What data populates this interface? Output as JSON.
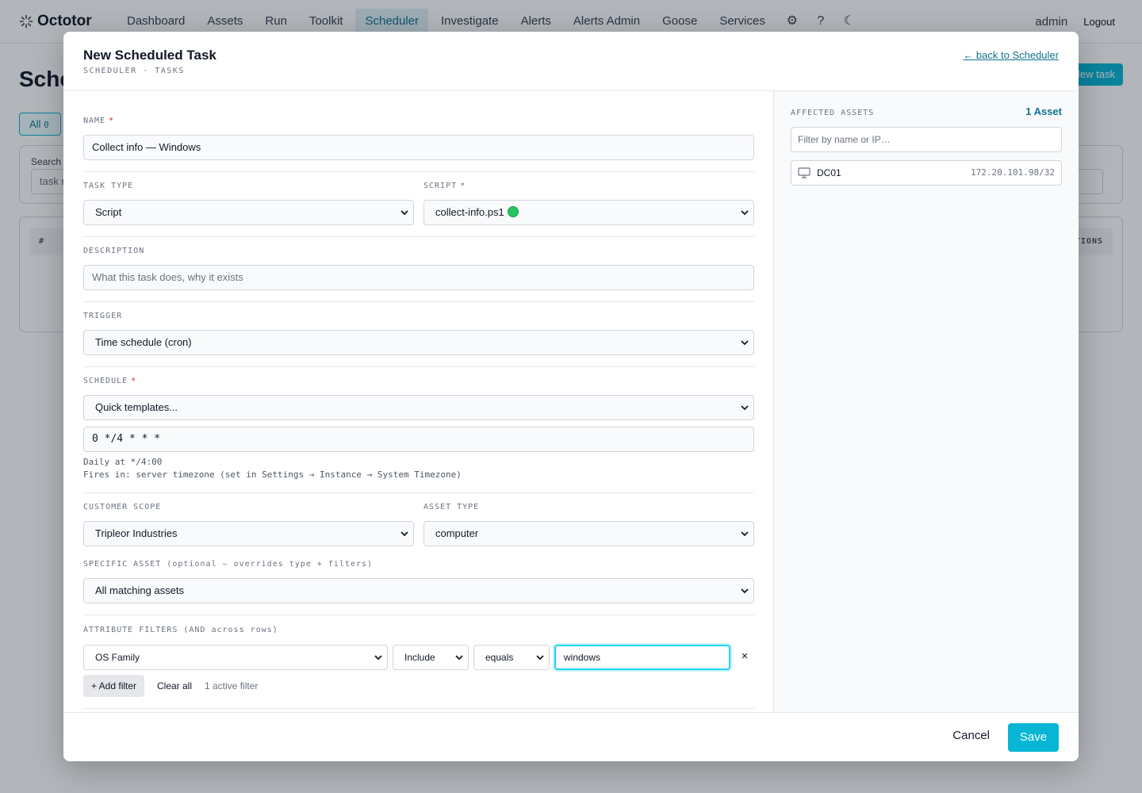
{
  "nav": {
    "brand": "Octotor",
    "items": [
      {
        "label": "Dashboard",
        "active": false
      },
      {
        "label": "Assets",
        "active": false
      },
      {
        "label": "Run",
        "active": false
      },
      {
        "label": "Toolkit",
        "active": false
      },
      {
        "label": "Scheduler",
        "active": true
      },
      {
        "label": "Investigate",
        "active": false
      },
      {
        "label": "Alerts",
        "active": false
      },
      {
        "label": "Alerts Admin",
        "active": false
      },
      {
        "label": "Goose",
        "active": false
      },
      {
        "label": "Services",
        "active": false
      }
    ],
    "icons": {
      "settings": "⚙",
      "help": "?",
      "theme": "☾"
    },
    "user": "admin",
    "logout": "Logout"
  },
  "background": {
    "page_title": "Sche",
    "new_task": "New task",
    "tab_all": "All",
    "tab_all_count": "0",
    "search_label": "Search",
    "search_value": "task n",
    "col_hash": "#",
    "col_actions": "TIONS"
  },
  "modal": {
    "title": "New Scheduled Task",
    "subtitle": "SCHEDULER · TASKS",
    "back_link": "← back to Scheduler",
    "form": {
      "name_label": "NAME",
      "name_value": "Collect info — Windows",
      "task_type_label": "TASK TYPE",
      "task_type_value": "Script",
      "script_label": "SCRIPT",
      "script_value": "collect-info.ps1",
      "description_label": "DESCRIPTION",
      "description_placeholder": "What this task does, why it exists",
      "trigger_label": "TRIGGER",
      "trigger_value": "Time schedule (cron)",
      "schedule_label": "SCHEDULE",
      "schedule_template": "Quick templates...",
      "cron_value": "0 */4 * * *",
      "schedule_desc": "Daily at */4:00",
      "schedule_tz": "Fires in: server timezone (set in Settings → Instance → System Timezone)",
      "customer_scope_label": "CUSTOMER SCOPE",
      "customer_scope_value": "Tripleor Industries",
      "asset_type_label": "ASSET TYPE",
      "asset_type_value": "computer",
      "specific_asset_label": "SPECIFIC ASSET (optional — overrides type + filters)",
      "specific_asset_value": "All matching assets",
      "attr_filters_label": "ATTRIBUTE FILTERS (AND across rows)",
      "filter": {
        "attribute": "OS Family",
        "mode": "Include",
        "operator": "equals",
        "value": "windows",
        "remove": "×"
      },
      "add_filter": "+ Add filter",
      "clear_all": "Clear all",
      "active_count": "1 active filter"
    },
    "side": {
      "label": "AFFECTED ASSETS",
      "count": "1 Asset",
      "filter_placeholder": "Filter by name or IP…",
      "assets": [
        {
          "name": "DC01",
          "ip": "172.20.101.98/32"
        }
      ]
    },
    "footer": {
      "cancel": "Cancel",
      "save": "Save"
    }
  },
  "colors": {
    "accent": "#06b6d4",
    "link": "#0e7490",
    "required": "#dc2626",
    "status_ok": "#22c55e"
  }
}
